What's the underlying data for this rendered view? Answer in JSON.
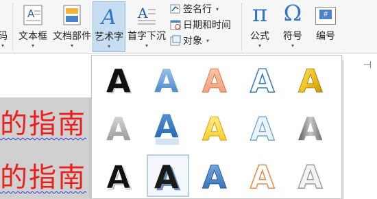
{
  "ribbon": {
    "cut_text": "码",
    "textbox_label": "文本框",
    "quickparts_label": "文档部件",
    "wordart_label": "艺术字",
    "dropcap_label": "首字下沉",
    "signature_label": "签名行",
    "datetime_label": "日期和时间",
    "object_label": "对象",
    "equation_label": "公式",
    "symbol_label": "符号",
    "number_label": "编号",
    "equation_glyph": "π",
    "symbol_glyph": "Ω",
    "number_glyph": "#",
    "wordart_glyph": "A",
    "pin_glyph": "⊣"
  },
  "document": {
    "lines": [
      "的指南",
      "的指南"
    ],
    "colors": {
      "text": "#e8211c",
      "underline": "#2c3bd6"
    }
  },
  "gallery": {
    "glyph": "A",
    "styles": [
      [
        "black-shadow",
        "blue-gradient",
        "orange-soft",
        "blue-outline",
        "gold-bevel"
      ],
      [
        "gray-gradient",
        "blue-reflect",
        "yellow-fill",
        "light-blue-outline",
        "gray-bevel"
      ],
      [
        "black-outline-shadow",
        "dark-shadow-selected",
        "blue-bevel",
        "orange-outline",
        "silver-outline"
      ]
    ]
  }
}
